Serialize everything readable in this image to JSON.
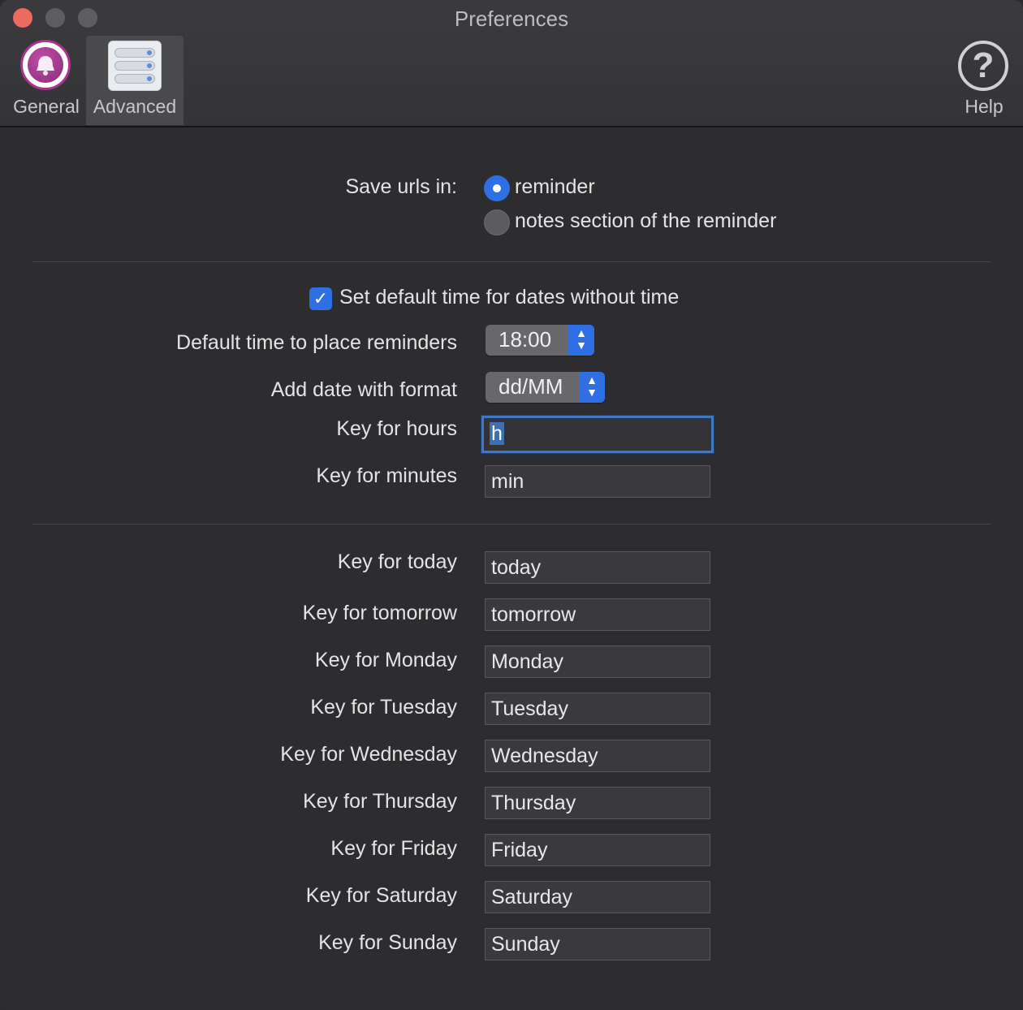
{
  "window": {
    "title": "Preferences"
  },
  "toolbar": {
    "items": [
      {
        "label": "General",
        "icon": "bell-icon"
      },
      {
        "label": "Advanced",
        "icon": "sliders-icon",
        "selected": true
      },
      {
        "label": "Help",
        "icon": "question-circle-icon"
      }
    ]
  },
  "save_urls": {
    "label": "Save urls in:",
    "options": [
      {
        "label": "reminder",
        "selected": true
      },
      {
        "label": "notes section of the reminder",
        "selected": false
      }
    ]
  },
  "default_time": {
    "checkbox_label": "Set default time for dates without time",
    "checked": true,
    "time_label": "Default time to place reminders",
    "time_value": "18:00"
  },
  "date_format": {
    "label": "Add date with format",
    "value": "dd/MM"
  },
  "keys": {
    "hours": {
      "label": "Key for hours",
      "value": "h"
    },
    "minutes": {
      "label": "Key for minutes",
      "value": "min"
    },
    "today": {
      "label": "Key for today",
      "value": "today"
    },
    "tomorrow": {
      "label": "Key for tomorrow",
      "value": "tomorrow"
    },
    "monday": {
      "label": "Key for Monday",
      "value": "Monday"
    },
    "tuesday": {
      "label": "Key for Tuesday",
      "value": "Tuesday"
    },
    "wednesday": {
      "label": "Key for Wednesday",
      "value": "Wednesday"
    },
    "thursday": {
      "label": "Key for Thursday",
      "value": "Thursday"
    },
    "friday": {
      "label": "Key for Friday",
      "value": "Friday"
    },
    "saturday": {
      "label": "Key for Saturday",
      "value": "Saturday"
    },
    "sunday": {
      "label": "Key for Sunday",
      "value": "Sunday"
    }
  },
  "colors": {
    "accent": "#2f6fe4",
    "background": "#2d2d2f",
    "close": "#ed6a5e"
  }
}
